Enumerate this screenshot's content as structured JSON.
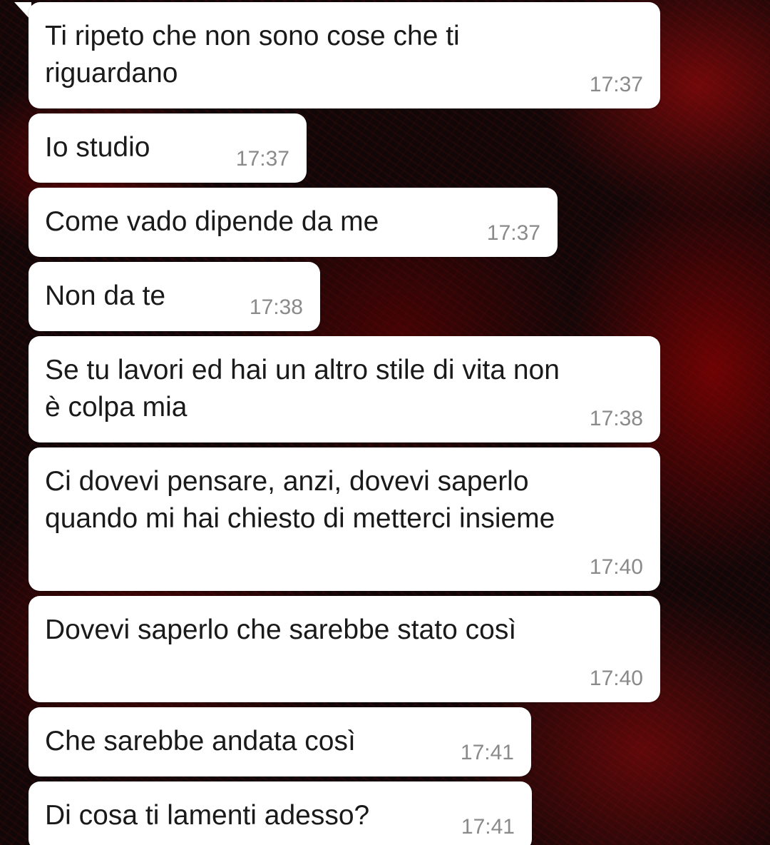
{
  "messages": [
    {
      "text": "Ti ripeto che non sono cose che ti\nriguardano",
      "time": "17:37"
    },
    {
      "text": "Io studio",
      "time": "17:37"
    },
    {
      "text": "Come vado dipende da me",
      "time": "17:37"
    },
    {
      "text": "Non da te",
      "time": "17:38"
    },
    {
      "text": "Se tu lavori ed hai un altro stile di vita non\nè colpa mia",
      "time": "17:38"
    },
    {
      "text": "Ci dovevi pensare, anzi, dovevi saperlo\nquando mi hai chiesto di metterci insieme",
      "time": "17:40"
    },
    {
      "text": "Dovevi saperlo che sarebbe stato così",
      "time": "17:40"
    },
    {
      "text": "Che sarebbe andata così",
      "time": "17:41"
    },
    {
      "text": "Di cosa ti lamenti adesso?",
      "time": "17:41"
    }
  ],
  "colors": {
    "bubble_background": "#ffffff",
    "message_text": "#1a1a1a",
    "timestamp_text": "#8a8a8a",
    "wallpaper_base": "#120708",
    "wallpaper_accent": "#b00000"
  }
}
